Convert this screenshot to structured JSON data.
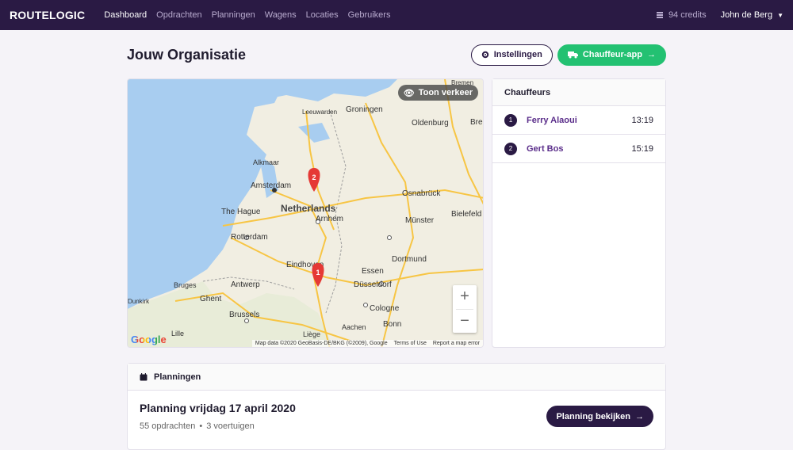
{
  "nav": {
    "brand": "ROUTELOGIC",
    "links": [
      "Dashboard",
      "Opdrachten",
      "Planningen",
      "Wagens",
      "Locaties",
      "Gebruikers"
    ],
    "credits": "94 credits",
    "user": "John de Berg"
  },
  "page": {
    "title": "Jouw Organisatie",
    "settings_label": "Instellingen",
    "driver_app_label": "Chauffeur-app"
  },
  "map": {
    "traffic_label": "Toon verkeer",
    "zoom_in": "+",
    "zoom_out": "−",
    "google": "Google",
    "footer": [
      "Map data ©2020 GeoBasis-DE/BKG (©2009), Google",
      "Terms of Use",
      "Report a map error"
    ],
    "cities": [
      "Groningen",
      "Leeuwarden",
      "Oldenburg",
      "Bremen",
      "Alkmaar",
      "Amsterdam",
      "The Hague",
      "Netherlands",
      "Arnhem",
      "Rotterdam",
      "Osnabrück",
      "Münster",
      "Bielefeld",
      "Eindhoven",
      "Dortmund",
      "Essen",
      "Düsseldorf",
      "Antwerp",
      "Bruges",
      "Ghent",
      "Dunkirk",
      "Brussels",
      "Cologne",
      "Bonn",
      "Aachen",
      "Liège",
      "Lille",
      "Bre"
    ],
    "markers": [
      "2",
      "1"
    ]
  },
  "drivers": {
    "title": "Chauffeurs",
    "items": [
      {
        "num": "1",
        "name": "Ferry Alaoui",
        "time": "13:19"
      },
      {
        "num": "2",
        "name": "Gert Bos",
        "time": "15:19"
      }
    ]
  },
  "planning": {
    "header": "Planningen",
    "title": "Planning vrijdag 17 april 2020",
    "orders": "55 opdrachten",
    "separator": "•",
    "vehicles": "3 voertuigen",
    "view_label": "Planning bekijken"
  },
  "colors": {
    "nav_bg": "#2a1a44",
    "accent_green": "#23c172",
    "driver_link": "#5a2d8a",
    "marker": "#e53935"
  }
}
